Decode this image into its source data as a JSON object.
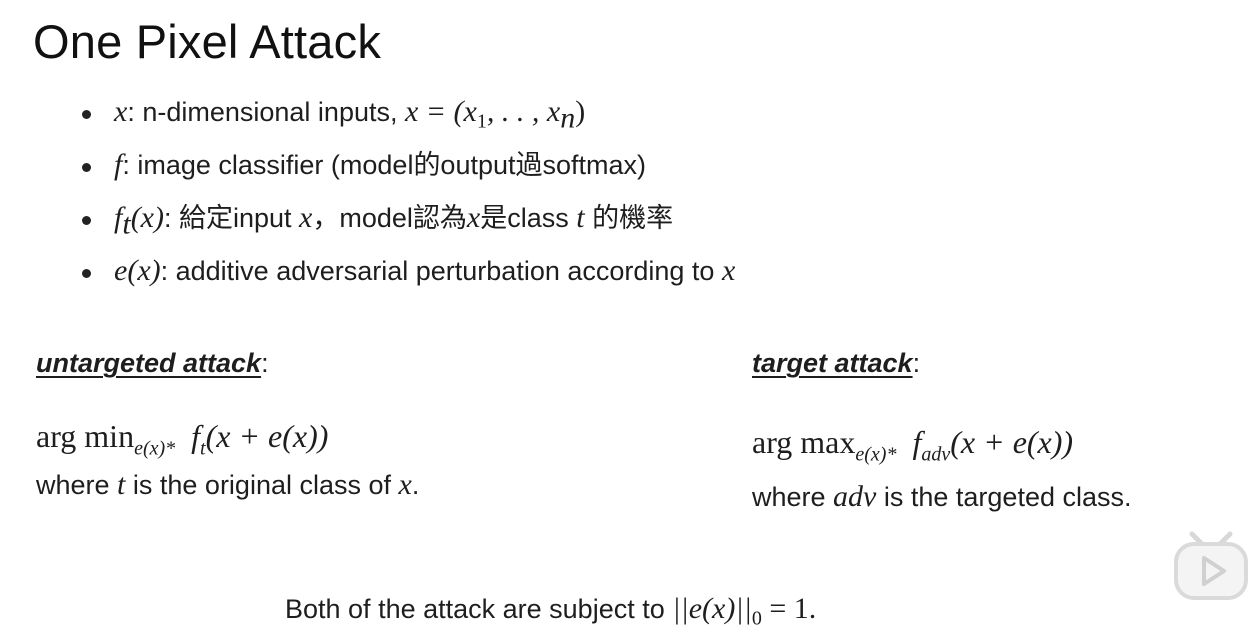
{
  "title": "One Pixel Attack",
  "bullets": [
    {
      "sym": "x",
      "text": ": n-dimensional inputs, ",
      "math": "x = (x",
      "sub1": "1",
      "mid": ", . . , x",
      "subn": "n",
      "end": ")"
    },
    {
      "sym": "f",
      "text": ": image classifier (model的output過softmax)"
    },
    {
      "sym": "f",
      "sub": "t",
      "paren": "(x)",
      "text": ": 給定input ",
      "x": "x",
      "text2": "，model認為",
      "x2": "x",
      "text3": "是class ",
      "t": "t",
      "text4": " 的機率"
    },
    {
      "sym": "e",
      "paren": "(x)",
      "text": ": additive adversarial perturbation according to ",
      "x": "x"
    }
  ],
  "untargeted": {
    "heading": "untargeted attack",
    "colon": ":",
    "formula_pre": "arg min",
    "formula_sub": "e(x)*",
    "formula_f": "f",
    "formula_fsub": "t",
    "formula_post": "(x + e(x))",
    "where_pre": "where ",
    "where_var": "t",
    "where_post": " is the original class of ",
    "where_x": "x",
    "where_end": "."
  },
  "targeted": {
    "heading": "target attack",
    "colon": ":",
    "formula_pre": "arg max",
    "formula_sub": "e(x)*",
    "formula_f": "f",
    "formula_fsub": "adv",
    "formula_post": "(x + e(x))",
    "where_pre": "where ",
    "where_var": "adv",
    "where_post": " is the targeted class."
  },
  "footer": {
    "text": "Both of the attack are subject to ",
    "math": "||e(x)||",
    "sub": "0",
    "eq": " = 1."
  },
  "icon": "play-button-icon"
}
